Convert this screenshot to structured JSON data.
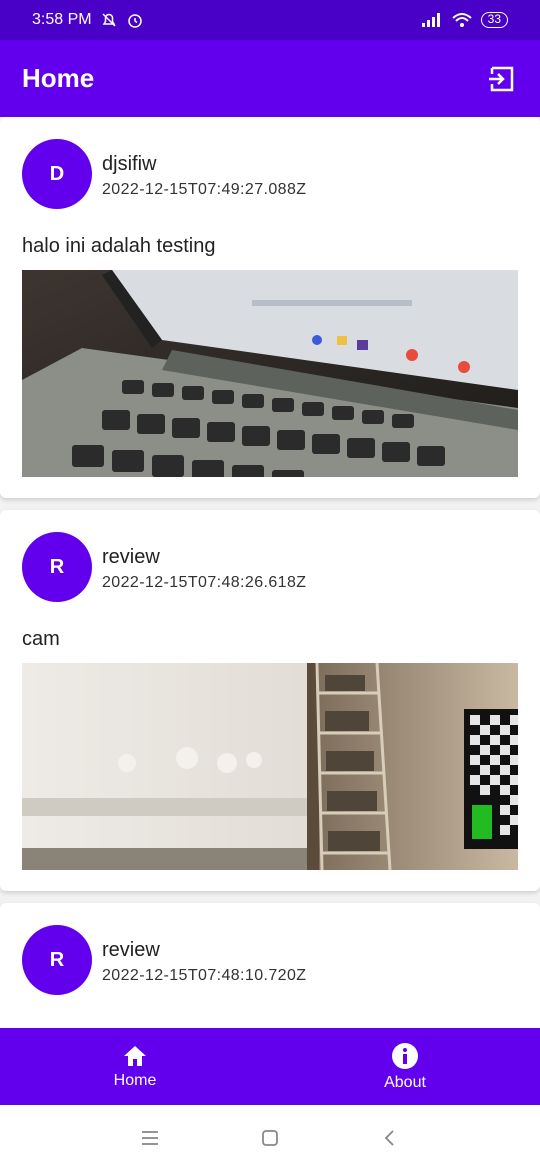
{
  "status_bar": {
    "time": "3:58 PM",
    "battery": "33"
  },
  "app_bar": {
    "title": "Home"
  },
  "posts": [
    {
      "avatar_letter": "D",
      "username": "djsifiw",
      "timestamp": "2022-12-15T07:49:27.088Z",
      "text": "halo ini adalah testing",
      "image_icon": "laptop-photo"
    },
    {
      "avatar_letter": "R",
      "username": "review",
      "timestamp": "2022-12-15T07:48:26.618Z",
      "text": "cam",
      "image_icon": "room-photo"
    },
    {
      "avatar_letter": "R",
      "username": "review",
      "timestamp": "2022-12-15T07:48:10.720Z",
      "text": ""
    }
  ],
  "bottom_nav": {
    "items": [
      {
        "label": "Home",
        "icon": "home-icon"
      },
      {
        "label": "About",
        "icon": "info-icon"
      }
    ]
  },
  "colors": {
    "primary": "#6200ee",
    "status_bar": "#4a01c7"
  }
}
